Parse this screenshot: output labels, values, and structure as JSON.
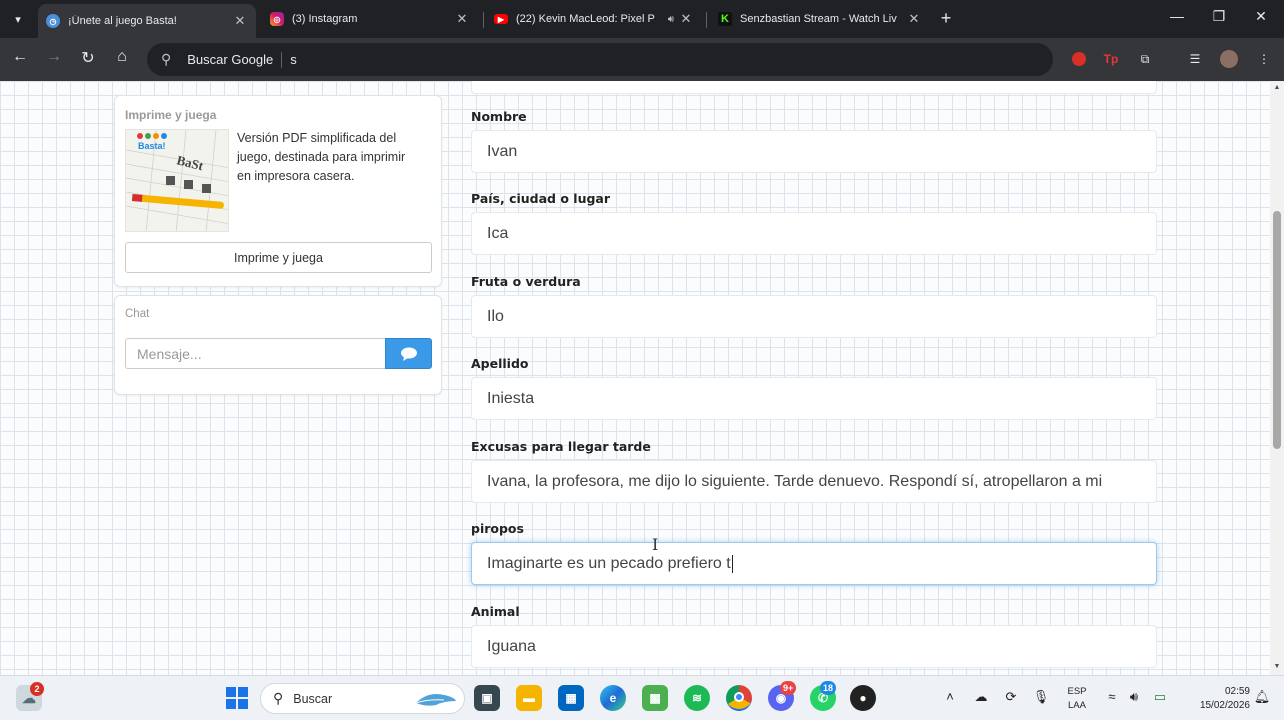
{
  "browser": {
    "tabs": [
      {
        "title": "¡Únete al juego Basta!",
        "active": true
      },
      {
        "title": "(3) Instagram",
        "active": false
      },
      {
        "title": "(22) Kevin MacLeod: Pixel P",
        "active": false
      },
      {
        "title": "Senzbastian Stream - Watch Liv",
        "active": false
      }
    ],
    "address": {
      "label": "Buscar Google",
      "value": "s"
    }
  },
  "sidebar": {
    "print": {
      "title": "Imprime y juega",
      "description": "Versión PDF simplificada del juego, destinada para imprimir en impresora casera.",
      "button": "Imprime y juega",
      "thumb_text": "Basta!"
    },
    "chat": {
      "title": "Chat",
      "placeholder": "Mensaje..."
    }
  },
  "form": {
    "fields": [
      {
        "label": "Nombre",
        "value": "Ivan"
      },
      {
        "label": "País, ciudad o lugar",
        "value": "Ica"
      },
      {
        "label": "Fruta o verdura",
        "value": "Ilo"
      },
      {
        "label": "Apellido",
        "value": "Iniesta"
      },
      {
        "label": "Excusas para llegar tarde",
        "value": "Ivana, la profesora, me dijo lo siguiente. Tarde denuevo. Respondí sí, atropellaron a mi"
      },
      {
        "label": "piropos",
        "value": "Imaginarte es un pecado prefiero t",
        "focused": true
      },
      {
        "label": "Animal",
        "value": "Iguana"
      }
    ]
  },
  "taskbar": {
    "weather_badge": "2",
    "search_label": "Buscar",
    "discord_badge": "9+",
    "whatsapp_badge": "18",
    "language": {
      "line1": "ESP",
      "line2": "LAA"
    },
    "time": "02:59",
    "date": "15/02/2026"
  },
  "colors": {
    "accent_blue": "#3a9ae8",
    "chrome_dark": "#202124",
    "chrome_toolbar": "#35363a"
  }
}
